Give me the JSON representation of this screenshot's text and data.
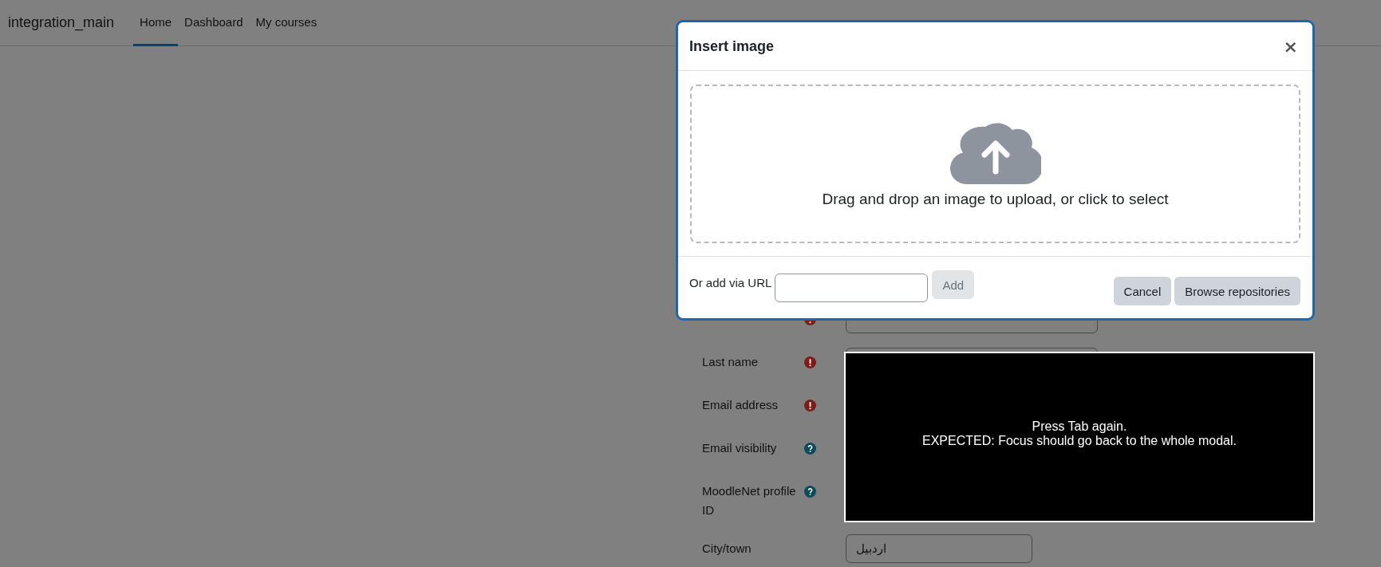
{
  "nav": {
    "site_name": "integration_main",
    "items": [
      {
        "label": "Home",
        "selected": true
      },
      {
        "label": "Dashboard",
        "selected": false
      },
      {
        "label": "My courses",
        "selected": false
      }
    ]
  },
  "form": {
    "rows": [
      {
        "kind": "required",
        "field": true
      },
      {
        "label": "Last name",
        "kind": "required",
        "field": true
      },
      {
        "label": "Email address",
        "kind": "required",
        "field": false
      },
      {
        "label": "Email visibility",
        "kind": "help",
        "field": false
      },
      {
        "label": "MoodleNet profile ID",
        "kind": "help",
        "field": false
      },
      {
        "label": "City/town",
        "kind": "plain",
        "field": true,
        "value": "اردبیل"
      }
    ]
  },
  "modal": {
    "title": "Insert image",
    "close": "×",
    "dropzone_text": "Drag and drop an image to upload, or click to select",
    "url_label": "Or add via URL",
    "add_button": {
      "label": "Add",
      "disabled": true
    },
    "buttons": [
      "Cancel",
      "Browse repositories"
    ]
  },
  "caption": {
    "lines": [
      "Press Tab again.",
      "EXPECTED: Focus should go back to the whole modal."
    ]
  }
}
